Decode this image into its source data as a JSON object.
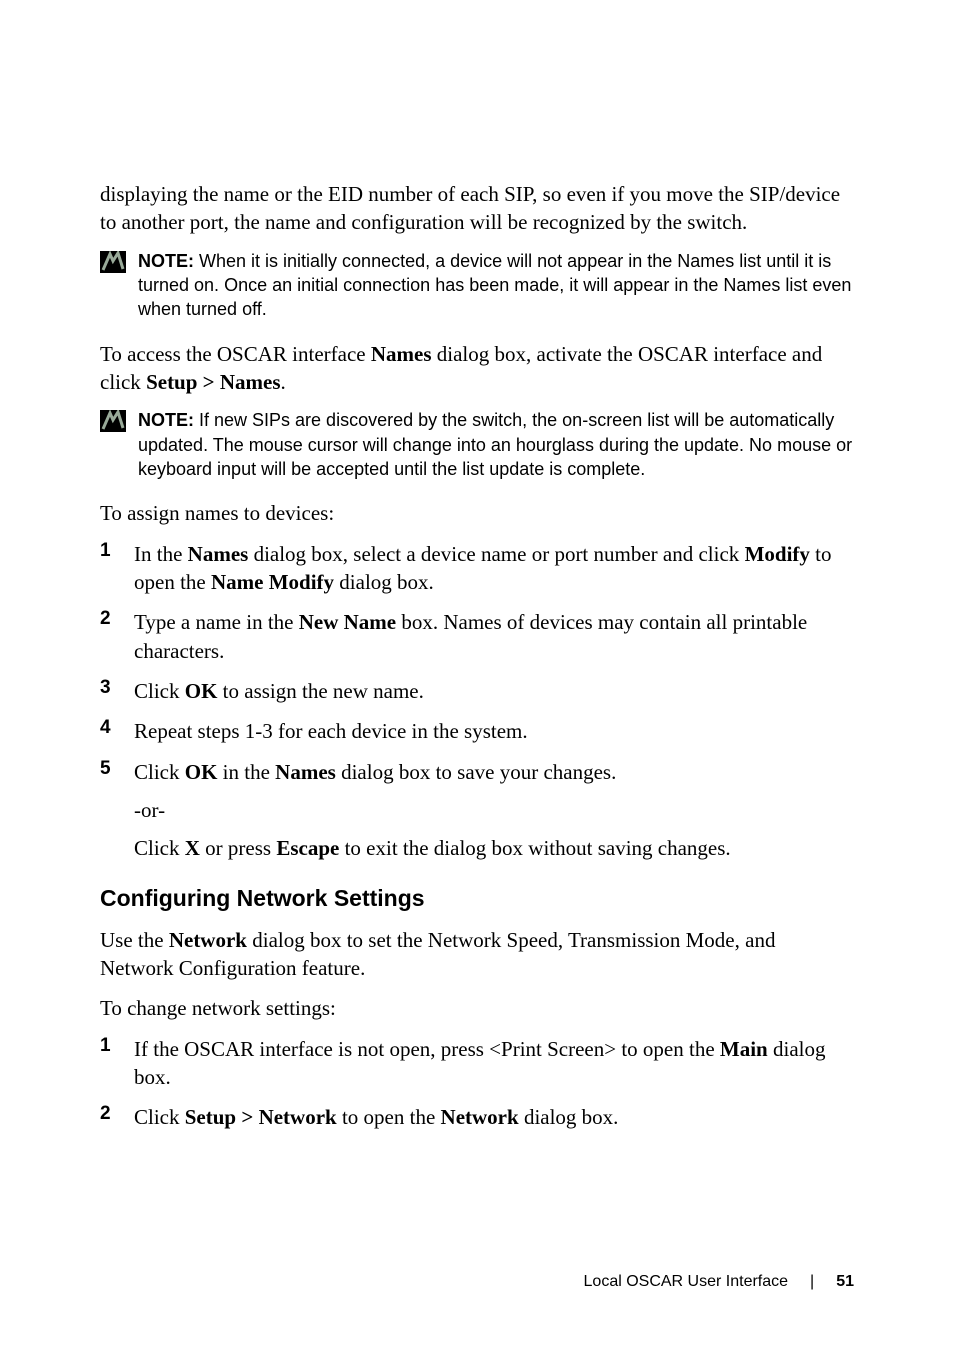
{
  "para_intro": "displaying the name or the EID number of each SIP, so even if you move the SIP/device to another port, the name and configuration will be recognized by the switch.",
  "note1": {
    "label": "NOTE:",
    "text": " When it is initially connected, a device will not appear in the Names list until it is turned on. Once an initial connection has been made, it will appear in the Names list even when turned off."
  },
  "para_access_pre": "To access the OSCAR interface ",
  "para_access_bold1": "Names",
  "para_access_mid": " dialog box, activate the OSCAR interface and click ",
  "para_access_bold2": "Setup > Names",
  "para_access_post": ".",
  "note2": {
    "label": "NOTE:",
    "text": " If new SIPs are discovered by the switch, the on-screen list will be automatically updated. The mouse cursor will change into an hourglass during the update. No mouse or keyboard input will be accepted until the list update is complete."
  },
  "para_assign": "To assign names to devices:",
  "steps1": {
    "s1": {
      "num": "1",
      "pre": "In the ",
      "b1": "Names",
      "mid1": " dialog box, select a device name or port number and click ",
      "b2": "Modify",
      "mid2": " to open the ",
      "b3": "Name Modify",
      "post": " dialog box."
    },
    "s2": {
      "num": "2",
      "pre": "Type a name in the ",
      "b1": "New Name",
      "post": " box. Names of devices may contain all printable characters."
    },
    "s3": {
      "num": "3",
      "pre": "Click ",
      "b1": "OK",
      "post": " to assign the new name."
    },
    "s4": {
      "num": "4",
      "text": "Repeat steps 1-3 for each device in the system."
    },
    "s5": {
      "num": "5",
      "pre": "Click ",
      "b1": "OK",
      "mid": " in the ",
      "b2": "Names",
      "post": " dialog box to save your changes.",
      "or": "-or-",
      "alt_pre": "Click ",
      "alt_b1": "X",
      "alt_mid": " or press ",
      "alt_b2": "Escape",
      "alt_post": " to exit the dialog box without saving changes."
    }
  },
  "section_heading": "Configuring Network Settings",
  "para_network_pre": "Use the ",
  "para_network_b1": "Network",
  "para_network_post": " dialog box to set the Network Speed, Transmission Mode, and Network Configuration feature.",
  "para_change": "To change network settings:",
  "steps2": {
    "s1": {
      "num": "1",
      "pre": "If the OSCAR interface is not open, press <Print Screen> to open the ",
      "b1": "Main",
      "post": " dialog box."
    },
    "s2": {
      "num": "2",
      "pre": "Click ",
      "b1": "Setup > Network",
      "mid": " to open the ",
      "b2": "Network",
      "post": " dialog box."
    }
  },
  "footer": {
    "title": "Local OSCAR User Interface",
    "page": "51"
  }
}
